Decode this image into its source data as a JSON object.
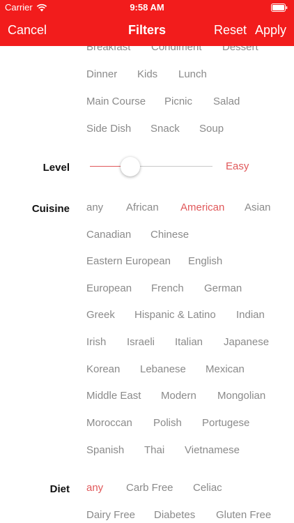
{
  "status_bar": {
    "carrier": "Carrier",
    "time": "9:58 AM"
  },
  "nav": {
    "cancel": "Cancel",
    "title": "Filters",
    "reset": "Reset",
    "apply": "Apply"
  },
  "course": {
    "rows": [
      [
        "Breakfast",
        "Condiment",
        "Dessert"
      ],
      [
        "Dinner",
        "Kids",
        "Lunch"
      ],
      [
        "Main Course",
        "Picnic",
        "Salad"
      ],
      [
        "Side Dish",
        "Snack",
        "Soup"
      ]
    ]
  },
  "level": {
    "label": "Level",
    "value_label": "Easy",
    "fraction": 0.33
  },
  "cuisine": {
    "label": "Cuisine",
    "selected": "American",
    "rows": [
      [
        "any",
        "African",
        "American",
        "Asian"
      ],
      [
        "Canadian",
        "Chinese"
      ],
      [
        "Eastern European",
        "English"
      ],
      [
        "European",
        "French",
        "German"
      ],
      [
        "Greek",
        "Hispanic & Latino",
        "Indian"
      ],
      [
        "Irish",
        "Israeli",
        "Italian",
        "Japanese"
      ],
      [
        "Korean",
        "Lebanese",
        "Mexican"
      ],
      [
        "Middle East",
        "Modern",
        "Mongolian"
      ],
      [
        "Moroccan",
        "Polish",
        "Portugese"
      ],
      [
        "Spanish",
        "Thai",
        "Vietnamese"
      ]
    ]
  },
  "diet": {
    "label": "Diet",
    "selected": "any",
    "rows": [
      [
        "any",
        "Carb Free",
        "Celiac"
      ],
      [
        "Dairy Free",
        "Diabetes",
        "Gluten Free"
      ]
    ]
  },
  "colors": {
    "header": "#f21c1c",
    "accent": "#e0585a",
    "chip": "#8a8a8a"
  }
}
